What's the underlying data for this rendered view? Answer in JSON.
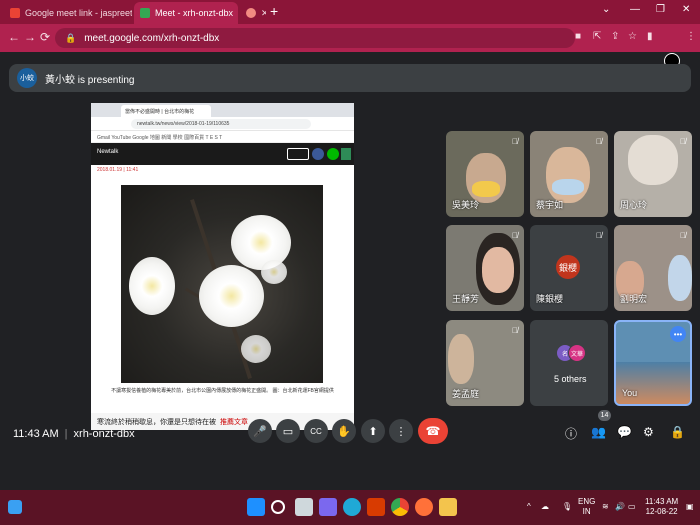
{
  "browser": {
    "tabs": [
      {
        "title": "Google meet link - jaspreet.k@",
        "favicon_color": "#ea4335"
      },
      {
        "title": "Meet - xrh-onzt-dbx",
        "favicon_color": "#34a853"
      },
      {
        "title": "",
        "favicon_color": "#f28b82"
      }
    ],
    "new_tab": "+",
    "window_controls": [
      "⌄",
      "—",
      "❐",
      "✕"
    ],
    "url": "meet.google.com/xrh-onzt-dbx"
  },
  "banner": {
    "avatar_text": "小蛟",
    "text": "黃小蛟 is presenting"
  },
  "shared_screen": {
    "tab_title": "當佈不必盛開時 | 台北市的梅花",
    "url": "newtalk.tw/news/view/2018-01-19/110635",
    "bookmarks": "Gmail   YouTube   Google 地圖   新聞   學校   國際百貨   T E S T",
    "site_name": "Newtalk",
    "date": "2018.01.19 | 11:41",
    "caption": "不讓寒拔信養植的梅花專美於前，台北市公園內傳展放傳的梅花正盛開。 圖：台北新花運FB官網提供",
    "footer_text": "寒流終於稍稍歇息，你還是只想待在被",
    "footer_link": "推薦文章"
  },
  "participants": [
    {
      "name": "吳美玲",
      "muted": true
    },
    {
      "name": "蔡宇如",
      "muted": true
    },
    {
      "name": "周心玲",
      "muted": true
    },
    {
      "name": "王靜芳",
      "muted": true
    },
    {
      "name": "陳銀櫻",
      "muted": true,
      "initials": "銀櫻",
      "initials_color": "#c1351d"
    },
    {
      "name": "劉明宏",
      "muted": true
    },
    {
      "name": "姜孟庭",
      "muted": true
    },
    {
      "name": "5 others",
      "others": true,
      "avatar_texts": [
        "名",
        "文華"
      ],
      "avatar_colors": [
        "#7b5cc4",
        "#d63384"
      ]
    },
    {
      "name": "You",
      "self": true
    }
  ],
  "meeting": {
    "time": "11:43 AM",
    "code": "xrh-onzt-dbx",
    "participant_count": "14"
  },
  "controls": {
    "mic_icon": "🎤",
    "camera_icon": "▭",
    "captions_icon": "CC",
    "raise_hand_icon": "✋",
    "present_icon": "⬆",
    "more_icon": "⋮",
    "end_call_icon": "☎",
    "info_icon": "ⓘ",
    "people_icon": "👥",
    "chat_icon": "💬",
    "activities_icon": "⚙",
    "lock_icon": "🔒"
  },
  "taskbar": {
    "language": "ENG\nIN",
    "lang_top": "ENG",
    "lang_bottom": "IN",
    "time": "11:43 AM",
    "date": "12-08-22"
  }
}
